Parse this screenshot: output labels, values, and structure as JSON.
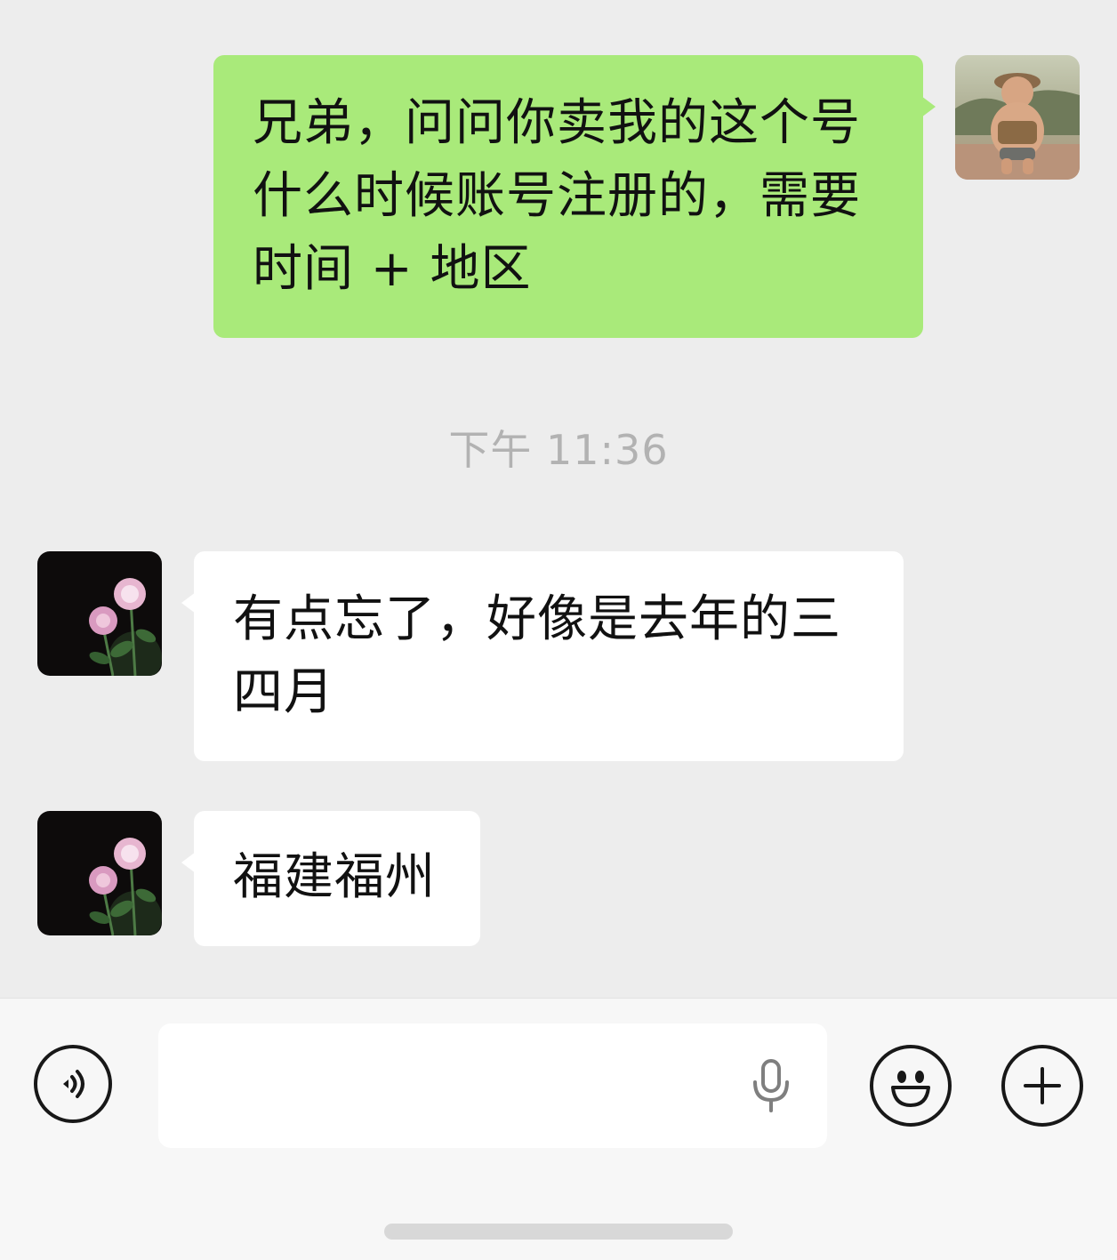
{
  "messages": {
    "outgoing_1": {
      "line1": "兄弟，问问你卖我的这个号",
      "line2": "什么时候账号注册的，需要",
      "line3": "时间 + 地区"
    },
    "timestamp": "下午 11:36",
    "incoming_1": {
      "line1": "有点忘了，好像是去年的三",
      "line2": "四月"
    },
    "incoming_2": {
      "line1": "福建福州"
    }
  },
  "avatars": {
    "self": "avatar-child-photo",
    "contact": "avatar-pink-roses"
  },
  "input_bar": {
    "voice_icon": "voice-mode-icon",
    "mic_icon": "microphone-icon",
    "emoji_icon": "emoji-icon",
    "plus_icon": "plus-icon"
  },
  "colors": {
    "background": "#ededed",
    "outgoing_bubble": "#a9ea7a",
    "incoming_bubble": "#ffffff",
    "timestamp_text": "#b2b2b2"
  }
}
